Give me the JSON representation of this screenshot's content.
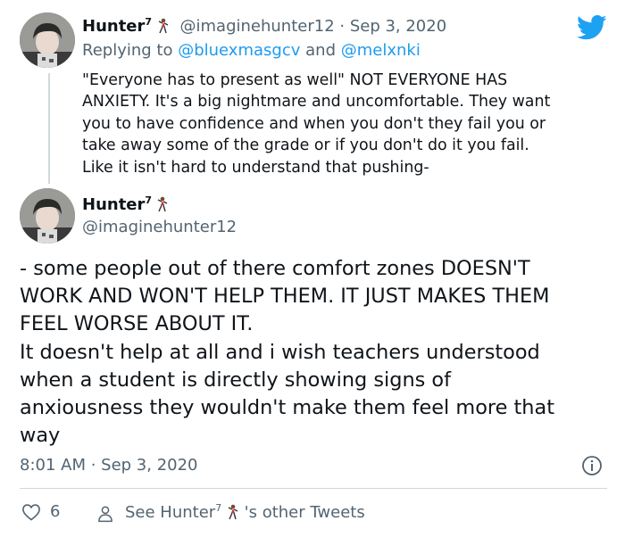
{
  "tweet1": {
    "name": "Hunter",
    "name_sup": "7",
    "handle_date": "@imaginehunter12 · Sep 3, 2020",
    "replying_prefix": "Replying to",
    "reply_user1": "@bluexmasgcv",
    "reply_and": "and",
    "reply_user2": "@melxnki",
    "text": "\"Everyone has to present as well\" NOT EVERYONE HAS\nANXIETY. It's a big nightmare and uncomfortable. They want\nyou to have confidence and when you don't they fail you or\ntake away some of the grade or if you don't do it you fail.\nLike it isn't hard to understand that pushing-"
  },
  "tweet2": {
    "name": "Hunter",
    "name_sup": "7",
    "handle": "@imaginehunter12",
    "text": "- some people out of there comfort zones DOESN'T\nWORK AND WON'T HELP THEM. IT JUST MAKES THEM\nFEEL WORSE ABOUT IT.\nIt doesn't help at all and i wish teachers understood\nwhen a student is directly showing signs of\nanxiousness they wouldn't make them feel more that\nway",
    "timestamp": "8:01 AM · Sep 3, 2020"
  },
  "actions": {
    "like_count": "6",
    "see_prefix": "See Hunter",
    "see_sup": "7",
    "see_suffix": "'s other Tweets"
  },
  "icons": {
    "brand": "twitter-bird-icon",
    "emoji": "dancing-man-emoji",
    "like": "heart-icon",
    "user": "person-icon",
    "info": "info-icon"
  },
  "colors": {
    "twitter_blue": "#1da1f2",
    "text": "#0f1419",
    "muted": "#536471",
    "divider": "#cfd9de"
  }
}
